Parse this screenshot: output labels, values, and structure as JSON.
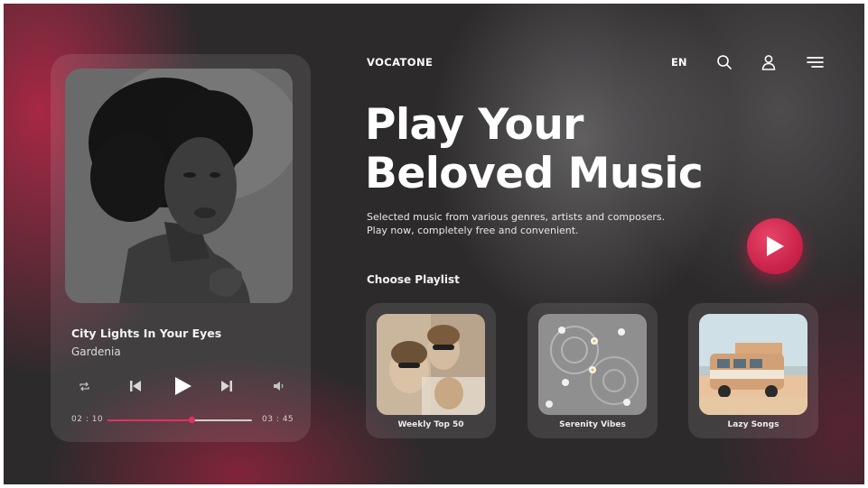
{
  "header": {
    "logo": "VOCATONE",
    "language": "EN",
    "icons": [
      "search-icon",
      "user-icon",
      "menu-icon"
    ]
  },
  "hero": {
    "headline_line1": "Play Your",
    "headline_line2": "Beloved Music",
    "subtitle_line1": "Selected music from various genres, artists and composers.",
    "subtitle_line2": "Play now, completely free and convenient."
  },
  "player": {
    "song_title": "City Lights In Your Eyes",
    "artist": "Gardenia",
    "time_current": "02 : 10",
    "time_total": "03 : 45",
    "progress": 0.58,
    "controls": [
      "repeat-icon",
      "previous-icon",
      "play-icon",
      "next-icon",
      "volume-icon"
    ]
  },
  "playlists": {
    "heading": "Choose Playlist",
    "items": [
      {
        "label": "Weekly Top 50"
      },
      {
        "label": "Serenity Vibes"
      },
      {
        "label": "Lazy Songs"
      }
    ]
  },
  "colors": {
    "accent": "#e0335f",
    "background": "#2d2a2c",
    "card": "rgba(255,255,255,0.10)"
  }
}
